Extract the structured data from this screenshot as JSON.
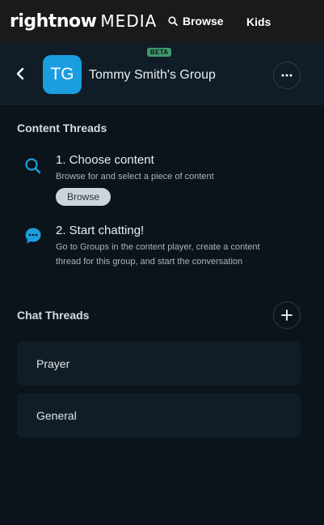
{
  "nav": {
    "logo_main": "rightnow",
    "logo_sub": "MEDIA",
    "browse_label": "Browse",
    "kids_label": "Kids"
  },
  "group": {
    "initials": "TG",
    "badge": "BETA",
    "name": "Tommy Smith's Group",
    "avatar_color": "#1a9ee0"
  },
  "content_threads": {
    "title": "Content Threads",
    "steps": [
      {
        "icon": "search-icon",
        "title": "1. Choose content",
        "description": "Browse for and select a piece of content",
        "button": "Browse"
      },
      {
        "icon": "chat-icon",
        "title": "2. Start chatting!",
        "description_line1": "Go to Groups in the content player, create a content",
        "description_line2": "thread for this group, and start the conversation"
      }
    ]
  },
  "chat_threads": {
    "title": "Chat Threads",
    "items": [
      "Prayer",
      "General"
    ]
  },
  "colors": {
    "background": "#0b141b",
    "card": "#101d27",
    "accent_blue": "#1a9ee0",
    "beta_green": "#3f9b6a"
  }
}
